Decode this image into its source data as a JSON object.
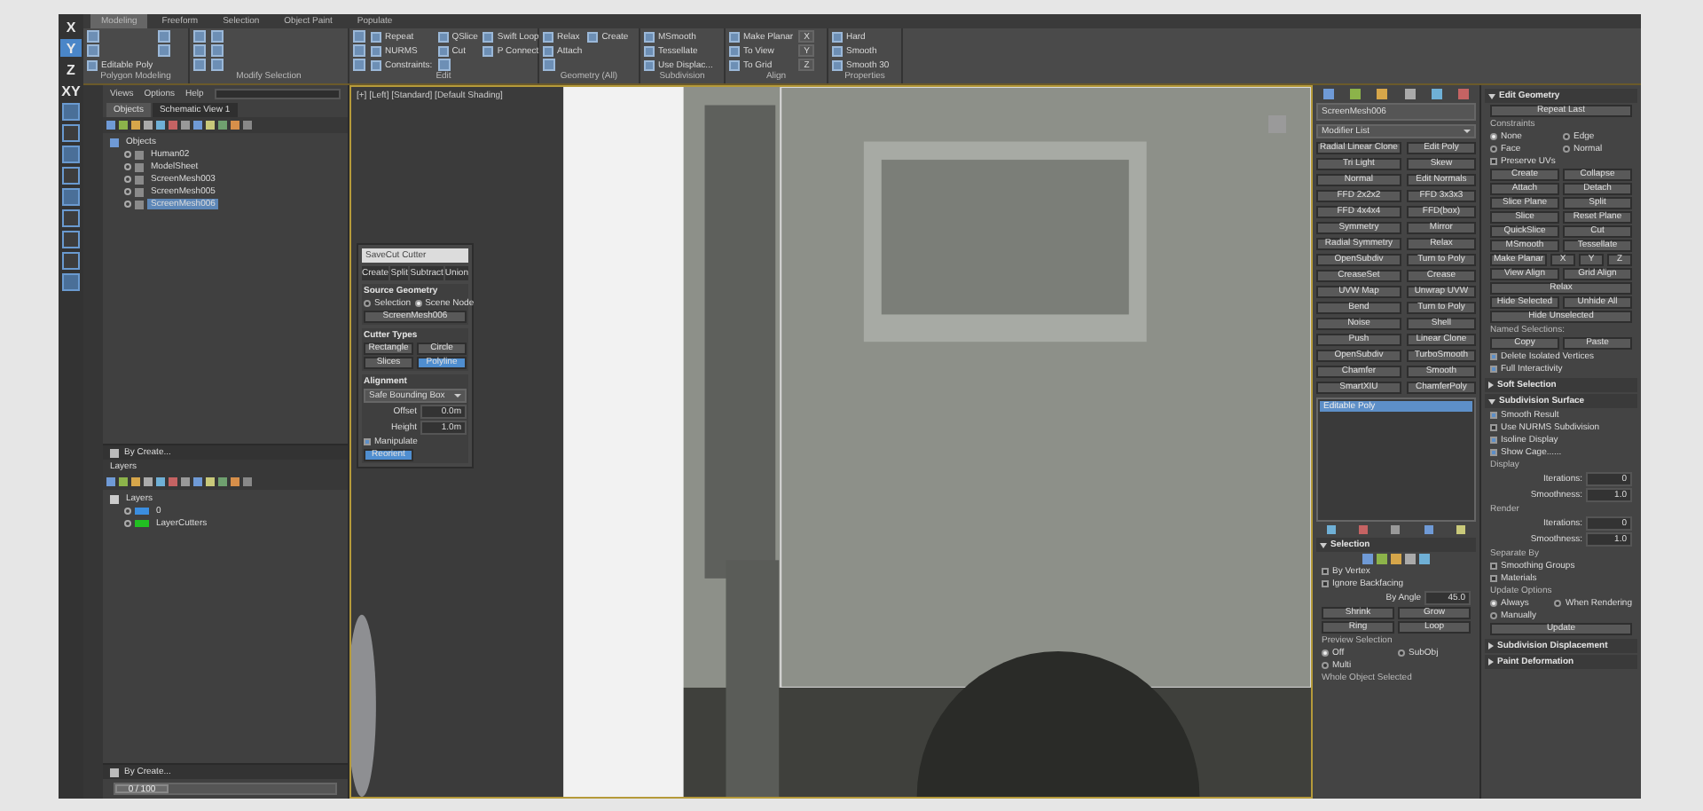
{
  "axis_toolbar": [
    {
      "label": "X",
      "selected": false
    },
    {
      "label": "Y",
      "selected": true
    },
    {
      "label": "Z",
      "selected": false
    },
    {
      "label": "XY",
      "selected": false
    }
  ],
  "ribbon": {
    "tabs": [
      {
        "label": "Modeling",
        "selected": true
      },
      {
        "label": "Freeform",
        "selected": false
      },
      {
        "label": "Selection",
        "selected": false
      },
      {
        "label": "Object Paint",
        "selected": false
      },
      {
        "label": "Populate",
        "selected": false
      }
    ],
    "groups": [
      {
        "label": "Polygon Modeling",
        "items": [
          {
            "kind": "icon"
          },
          {
            "kind": "icon"
          },
          {
            "kind": "tool",
            "label": "Editable Poly"
          },
          {
            "kind": "icon"
          },
          {
            "kind": "icon"
          }
        ]
      },
      {
        "label": "Modify Selection",
        "items": [
          {
            "kind": "icon"
          },
          {
            "kind": "icon"
          },
          {
            "kind": "icon"
          },
          {
            "kind": "icon"
          },
          {
            "kind": "icon"
          },
          {
            "kind": "icon"
          }
        ]
      },
      {
        "label": "Edit",
        "items": [
          {
            "kind": "icon"
          },
          {
            "kind": "icon"
          },
          {
            "kind": "icon"
          },
          {
            "kind": "tool",
            "label": "Repeat"
          },
          {
            "kind": "tool",
            "label": "NURMS"
          },
          {
            "kind": "tool",
            "label": "Constraints:"
          },
          {
            "kind": "tool",
            "label": "QSlice"
          },
          {
            "kind": "tool",
            "label": "Cut"
          },
          {
            "kind": "icon"
          },
          {
            "kind": "tool",
            "label": "Swift Loop"
          },
          {
            "kind": "tool",
            "label": "P Connect"
          }
        ]
      },
      {
        "label": "Geometry (All)",
        "items": [
          {
            "kind": "tool",
            "label": "Relax"
          },
          {
            "kind": "tool",
            "label": "Attach"
          },
          {
            "kind": "icon"
          },
          {
            "kind": "tool",
            "label": "Create"
          }
        ]
      },
      {
        "label": "Subdivision",
        "items": [
          {
            "kind": "tool",
            "label": "MSmooth"
          },
          {
            "kind": "tool",
            "label": "Tessellate"
          },
          {
            "kind": "tool",
            "label": "Use Displac..."
          }
        ]
      },
      {
        "label": "Align",
        "items": [
          {
            "kind": "tool",
            "label": "Make Planar"
          },
          {
            "kind": "tool",
            "label": "To View"
          },
          {
            "kind": "tool",
            "label": "To Grid"
          },
          {
            "kind": "axis",
            "label": "X"
          },
          {
            "kind": "axis",
            "label": "Y"
          },
          {
            "kind": "axis",
            "label": "Z"
          }
        ]
      },
      {
        "label": "Properties",
        "items": [
          {
            "kind": "tool",
            "label": "Hard"
          },
          {
            "kind": "tool",
            "label": "Smooth"
          },
          {
            "kind": "tool",
            "label": "Smooth 30"
          }
        ]
      }
    ]
  },
  "scene_explorer": {
    "menu": [
      "Views",
      "Options",
      "Help"
    ],
    "tabs": [
      {
        "label": "Objects",
        "selected": true
      },
      {
        "label": "Schematic View 1",
        "selected": false
      }
    ],
    "tree": {
      "label": "Objects",
      "children": [
        {
          "label": "Human02",
          "selected": false
        },
        {
          "label": "ModelSheet",
          "selected": false
        },
        {
          "label": "ScreenMesh003",
          "selected": false
        },
        {
          "label": "ScreenMesh005",
          "selected": false
        },
        {
          "label": "ScreenMesh006",
          "selected": true
        }
      ]
    },
    "footer": "By Create..."
  },
  "layer_explorer": {
    "title": "Layers",
    "tree": {
      "label": "Layers",
      "children": [
        {
          "label": "0",
          "color": "#3b8ee0"
        },
        {
          "label": "LayerCutters",
          "color": "#22c022"
        }
      ]
    },
    "footer": "By Create..."
  },
  "time_slider": {
    "label": "0 / 100",
    "level": 0
  },
  "viewport": {
    "label": "[+] [Left] [Standard] [Default Shading]",
    "dialog": {
      "title": "SaveCut Cutter",
      "tabs": [
        "Create",
        "Split",
        "Subtract",
        "Union"
      ],
      "sections": [
        {
          "title": "Source Geometry",
          "items": [
            {
              "kind": "radios",
              "options": [
                {
                  "label": "Selection",
                  "selected": false
                },
                {
                  "label": "Scene Node",
                  "selected": true
                }
              ]
            },
            {
              "kind": "button",
              "label": "ScreenMesh006"
            }
          ]
        },
        {
          "title": "Cutter Types",
          "items": [
            {
              "kind": "toggles",
              "options": [
                {
                  "label": "Rectangle",
                  "selected": false
                },
                {
                  "label": "Circle",
                  "selected": false
                },
                {
                  "label": "Slices",
                  "selected": false
                },
                {
                  "label": "Polyline",
                  "selected": true
                }
              ]
            }
          ]
        },
        {
          "title": "Alignment",
          "items": [
            {
              "kind": "dropdown",
              "value": "Safe Bounding Box"
            },
            {
              "kind": "spinner",
              "label": "Offset",
              "value": "0.0m"
            },
            {
              "kind": "spinner",
              "label": "Height",
              "value": "1.0m"
            },
            {
              "kind": "check",
              "label": "Manipulate",
              "checked": true
            },
            {
              "kind": "toggles",
              "options": [
                {
                  "label": "Reorient",
                  "selected": true
                }
              ]
            }
          ]
        }
      ]
    }
  },
  "command_panel": {
    "object_name": "ScreenMesh006",
    "modifier_list": "Modifier List",
    "modifier_buttons": [
      "Radial Linear Clone",
      "Edit Poly",
      "Tri Light",
      "Skew",
      "Normal",
      "Edit Normals",
      "FFD 2x2x2",
      "FFD 3x3x3",
      "FFD 4x4x4",
      "FFD(box)",
      "Symmetry",
      "Mirror",
      "Radial Symmetry",
      "Relax",
      "OpenSubdiv",
      "Turn to Poly",
      "CreaseSet",
      "Crease",
      "UVW Map",
      "Unwrap UVW",
      "Bend",
      "Turn to Poly",
      "Noise",
      "Shell",
      "Push",
      "Linear Clone",
      "OpenSubdiv",
      "TurboSmooth",
      "Chamfer",
      "Smooth",
      "SmartXIU",
      "ChamferPoly"
    ],
    "stack": [
      {
        "label": "Editable Poly",
        "selected": true
      }
    ],
    "selection": {
      "title": "Selection",
      "expanded": true,
      "items": [
        {
          "kind": "subobject-icons"
        },
        {
          "kind": "check",
          "label": "By Vertex",
          "checked": false
        },
        {
          "kind": "check",
          "label": "Ignore Backfacing",
          "checked": false
        },
        {
          "kind": "spinner",
          "label": "By Angle",
          "value": "45.0"
        },
        {
          "kind": "buttons",
          "labels": [
            "Shrink",
            "Grow"
          ]
        },
        {
          "kind": "buttons",
          "labels": [
            "Ring",
            "Loop"
          ]
        },
        {
          "kind": "label",
          "text": "Preview Selection"
        },
        {
          "kind": "radios",
          "options": [
            {
              "label": "Off",
              "selected": true
            },
            {
              "label": "SubObj",
              "selected": false
            },
            {
              "label": "Multi",
              "selected": false
            }
          ]
        },
        {
          "kind": "label",
          "text": "Whole Object Selected"
        }
      ]
    }
  },
  "edit_panel": {
    "rollouts": [
      {
        "title": "Edit Geometry",
        "expanded": true,
        "items": [
          {
            "kind": "button",
            "label": "Repeat Last"
          },
          {
            "kind": "label",
            "text": "Constraints"
          },
          {
            "kind": "radios",
            "options": [
              {
                "label": "None",
                "selected": true
              },
              {
                "label": "Edge",
                "selected": false
              },
              {
                "label": "Face",
                "selected": false
              },
              {
                "label": "Normal",
                "selected": false
              }
            ]
          },
          {
            "kind": "check",
            "label": "Preserve UVs",
            "checked": false
          },
          {
            "kind": "buttons",
            "labels": [
              "Create",
              "Collapse"
            ]
          },
          {
            "kind": "buttons",
            "labels": [
              "Attach",
              "Detach"
            ]
          },
          {
            "kind": "buttons",
            "labels": [
              "Slice Plane",
              "Split"
            ]
          },
          {
            "kind": "buttons",
            "labels": [
              "Slice",
              "Reset Plane"
            ]
          },
          {
            "kind": "buttons",
            "labels": [
              "QuickSlice",
              "Cut"
            ]
          },
          {
            "kind": "buttons",
            "labels": [
              "MSmooth",
              "Tessellate"
            ]
          },
          {
            "kind": "buttons",
            "labels": [
              "Make Planar",
              "X",
              "Y",
              "Z"
            ]
          },
          {
            "kind": "buttons",
            "labels": [
              "View Align",
              "Grid Align"
            ]
          },
          {
            "kind": "button",
            "label": "Relax"
          },
          {
            "kind": "buttons",
            "labels": [
              "Hide Selected",
              "Unhide All"
            ]
          },
          {
            "kind": "button",
            "label": "Hide Unselected"
          },
          {
            "kind": "label",
            "text": "Named Selections:"
          },
          {
            "kind": "buttons",
            "labels": [
              "Copy",
              "Paste"
            ]
          },
          {
            "kind": "check",
            "label": "Delete Isolated Vertices",
            "checked": true
          },
          {
            "kind": "check",
            "label": "Full Interactivity",
            "checked": true
          }
        ]
      },
      {
        "title": "Soft Selection",
        "expanded": false
      },
      {
        "title": "Subdivision Surface",
        "expanded": true,
        "items": [
          {
            "kind": "check",
            "label": "Smooth Result",
            "checked": true
          },
          {
            "kind": "check",
            "label": "Use NURMS Subdivision",
            "checked": false
          },
          {
            "kind": "check",
            "label": "Isoline Display",
            "checked": true
          },
          {
            "kind": "check",
            "label": "Show Cage......",
            "checked": true
          },
          {
            "kind": "label",
            "text": "Display"
          },
          {
            "kind": "spinner",
            "label": "Iterations:",
            "value": "0"
          },
          {
            "kind": "spinner",
            "label": "Smoothness:",
            "value": "1.0"
          },
          {
            "kind": "label",
            "text": "Render"
          },
          {
            "kind": "spinner",
            "label": "Iterations:",
            "value": "0"
          },
          {
            "kind": "spinner",
            "label": "Smoothness:",
            "value": "1.0"
          },
          {
            "kind": "label",
            "text": "Separate By"
          },
          {
            "kind": "check",
            "label": "Smoothing Groups",
            "checked": false
          },
          {
            "kind": "check",
            "label": "Materials",
            "checked": false
          },
          {
            "kind": "label",
            "text": "Update Options"
          },
          {
            "kind": "radios",
            "options": [
              {
                "label": "Always",
                "selected": true
              },
              {
                "label": "When Rendering",
                "selected": false
              },
              {
                "label": "Manually",
                "selected": false
              }
            ]
          },
          {
            "kind": "button",
            "label": "Update"
          }
        ]
      },
      {
        "title": "Subdivision Displacement",
        "expanded": false
      },
      {
        "title": "Paint Deformation",
        "expanded": false
      }
    ]
  }
}
